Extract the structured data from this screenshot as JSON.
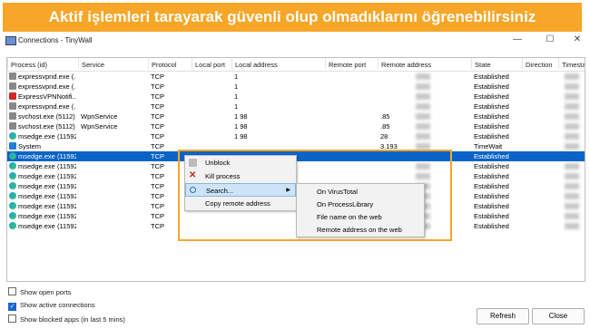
{
  "banner": {
    "text": "Aktif işlemleri tarayarak güvenli olup olmadıklarını öğrenebilirsiniz"
  },
  "window": {
    "title": "Connections - TinyWall",
    "minimize": "—",
    "maximize": "☐",
    "close": "✕"
  },
  "columns": [
    "Process (id)",
    "Service",
    "Protocol",
    "Local port",
    "Local address",
    "Remote port",
    "Remote address",
    "State",
    "Direction",
    "Timestam"
  ],
  "rows": [
    {
      "icon": "vpn",
      "process": "expressvpnd.exe (...",
      "service": "",
      "protocol": "TCP",
      "local_address": "1",
      "remote_address": "",
      "state": "Established"
    },
    {
      "icon": "vpn",
      "process": "expressvpnd.exe (...",
      "service": "",
      "protocol": "TCP",
      "local_address": "1",
      "remote_address": "",
      "state": "Established"
    },
    {
      "icon": "exp",
      "process": "ExpressVPNNotifi...",
      "service": "",
      "protocol": "TCP",
      "local_address": "1",
      "remote_address": "",
      "state": "Established"
    },
    {
      "icon": "vpn",
      "process": "expressvpnd.exe (...",
      "service": "",
      "protocol": "TCP",
      "local_address": "1",
      "remote_address": "",
      "state": "Established"
    },
    {
      "icon": "vpn",
      "process": "svchost.exe (5112)",
      "service": "WpnService",
      "protocol": "TCP",
      "local_address": "1            98",
      "remote_address": ".85",
      "state": "Established"
    },
    {
      "icon": "vpn",
      "process": "svchost.exe (5112)",
      "service": "WpnService",
      "protocol": "TCP",
      "local_address": "1            98",
      "remote_address": ".85",
      "state": "Established"
    },
    {
      "icon": "edge",
      "process": "msedge.exe (11592)",
      "service": "",
      "protocol": "TCP",
      "local_address": "1            98",
      "remote_address": "28",
      "state": "Established"
    },
    {
      "icon": "win",
      "process": "System",
      "service": "",
      "protocol": "TCP",
      "local_address": "",
      "remote_address": "3.193",
      "state": "TimeWait"
    },
    {
      "icon": "edge",
      "process": "msedge.exe (11592)",
      "service": "",
      "protocol": "TCP",
      "local_address": "",
      "remote_address": "",
      "state": "Established",
      "selected": true
    },
    {
      "icon": "edge",
      "process": "msedge.exe (11592)",
      "service": "",
      "protocol": "TCP",
      "local_address": "",
      "remote_address": "",
      "state": "Established"
    },
    {
      "icon": "edge",
      "process": "msedge.exe (11592)",
      "service": "",
      "protocol": "TCP",
      "local_address": "",
      "remote_address": "",
      "state": "Established"
    },
    {
      "icon": "edge",
      "process": "msedge.exe (11592)",
      "service": "",
      "protocol": "TCP",
      "local_address": "",
      "remote_address": "",
      "state": "Established"
    },
    {
      "icon": "edge",
      "process": "msedge.exe (11592)",
      "service": "",
      "protocol": "TCP",
      "local_address": "",
      "remote_address": "",
      "state": "Established"
    },
    {
      "icon": "edge",
      "process": "msedge.exe (11592)",
      "service": "",
      "protocol": "TCP",
      "local_address": "",
      "remote_address": "",
      "state": "Established"
    },
    {
      "icon": "edge",
      "process": "msedge.exe (11592)",
      "service": "",
      "protocol": "TCP",
      "local_address": "",
      "remote_address": "",
      "state": "Established"
    },
    {
      "icon": "edge",
      "process": "msedge.exe (11592)",
      "service": "",
      "protocol": "TCP",
      "local_address": "",
      "remote_address": "",
      "state": "Established"
    }
  ],
  "context_menu": {
    "unblock": "Unblock",
    "kill": "Kill process",
    "search": "Search...",
    "copy": "Copy remote address"
  },
  "submenu": {
    "virustotal": "On VirusTotal",
    "processlibrary": "On ProcessLibrary",
    "filename": "File name on the web",
    "remote": "Remote address on the web"
  },
  "options": {
    "open_ports": "Show open ports",
    "active": "Show active connections",
    "blocked": "Show blocked apps (in last 5 mins)"
  },
  "buttons": {
    "refresh": "Refresh",
    "close": "Close"
  },
  "colors": {
    "banner": "#f7a627",
    "selection": "#0a64c8"
  }
}
